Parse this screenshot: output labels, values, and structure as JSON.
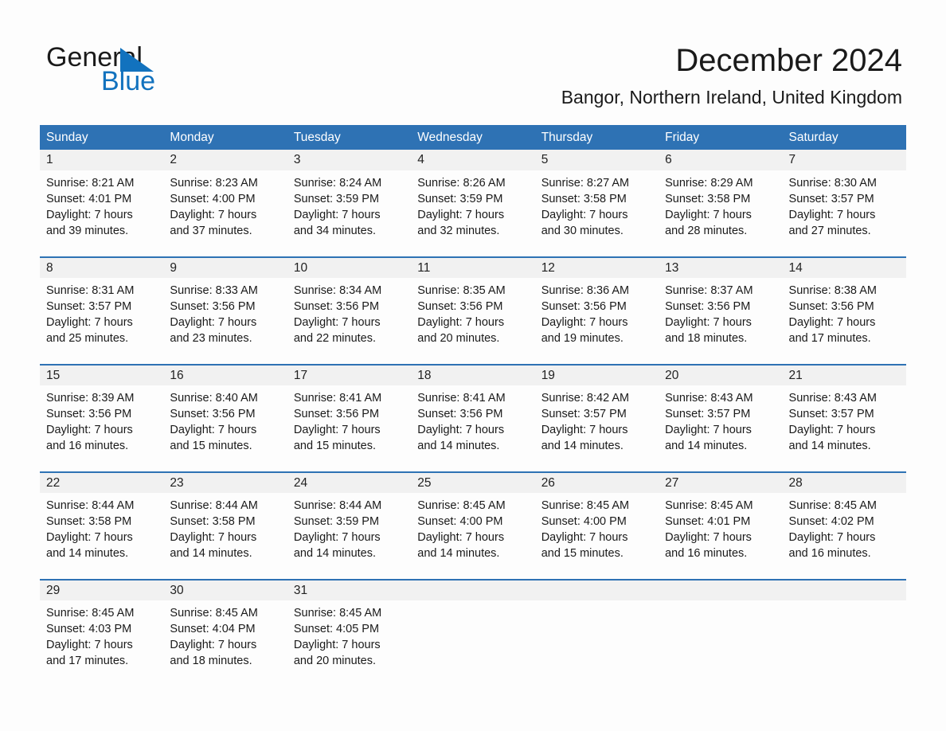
{
  "brand": {
    "name_part1": "General",
    "name_part2": "Blue",
    "accent_color": "#1272be"
  },
  "header": {
    "title": "December 2024",
    "subtitle": "Bangor, Northern Ireland, United Kingdom"
  },
  "theme": {
    "header_blue": "#2e72b4",
    "daynum_gray": "#f1f1f1",
    "page_background": "#fdfdfd"
  },
  "calendar": {
    "weekdays": [
      "Sunday",
      "Monday",
      "Tuesday",
      "Wednesday",
      "Thursday",
      "Friday",
      "Saturday"
    ],
    "weeks": [
      {
        "days": [
          {
            "num": "1",
            "sunrise": "Sunrise: 8:21 AM",
            "sunset": "Sunset: 4:01 PM",
            "daylight_line1": "Daylight: 7 hours",
            "daylight_line2": "and 39 minutes."
          },
          {
            "num": "2",
            "sunrise": "Sunrise: 8:23 AM",
            "sunset": "Sunset: 4:00 PM",
            "daylight_line1": "Daylight: 7 hours",
            "daylight_line2": "and 37 minutes."
          },
          {
            "num": "3",
            "sunrise": "Sunrise: 8:24 AM",
            "sunset": "Sunset: 3:59 PM",
            "daylight_line1": "Daylight: 7 hours",
            "daylight_line2": "and 34 minutes."
          },
          {
            "num": "4",
            "sunrise": "Sunrise: 8:26 AM",
            "sunset": "Sunset: 3:59 PM",
            "daylight_line1": "Daylight: 7 hours",
            "daylight_line2": "and 32 minutes."
          },
          {
            "num": "5",
            "sunrise": "Sunrise: 8:27 AM",
            "sunset": "Sunset: 3:58 PM",
            "daylight_line1": "Daylight: 7 hours",
            "daylight_line2": "and 30 minutes."
          },
          {
            "num": "6",
            "sunrise": "Sunrise: 8:29 AM",
            "sunset": "Sunset: 3:58 PM",
            "daylight_line1": "Daylight: 7 hours",
            "daylight_line2": "and 28 minutes."
          },
          {
            "num": "7",
            "sunrise": "Sunrise: 8:30 AM",
            "sunset": "Sunset: 3:57 PM",
            "daylight_line1": "Daylight: 7 hours",
            "daylight_line2": "and 27 minutes."
          }
        ]
      },
      {
        "days": [
          {
            "num": "8",
            "sunrise": "Sunrise: 8:31 AM",
            "sunset": "Sunset: 3:57 PM",
            "daylight_line1": "Daylight: 7 hours",
            "daylight_line2": "and 25 minutes."
          },
          {
            "num": "9",
            "sunrise": "Sunrise: 8:33 AM",
            "sunset": "Sunset: 3:56 PM",
            "daylight_line1": "Daylight: 7 hours",
            "daylight_line2": "and 23 minutes."
          },
          {
            "num": "10",
            "sunrise": "Sunrise: 8:34 AM",
            "sunset": "Sunset: 3:56 PM",
            "daylight_line1": "Daylight: 7 hours",
            "daylight_line2": "and 22 minutes."
          },
          {
            "num": "11",
            "sunrise": "Sunrise: 8:35 AM",
            "sunset": "Sunset: 3:56 PM",
            "daylight_line1": "Daylight: 7 hours",
            "daylight_line2": "and 20 minutes."
          },
          {
            "num": "12",
            "sunrise": "Sunrise: 8:36 AM",
            "sunset": "Sunset: 3:56 PM",
            "daylight_line1": "Daylight: 7 hours",
            "daylight_line2": "and 19 minutes."
          },
          {
            "num": "13",
            "sunrise": "Sunrise: 8:37 AM",
            "sunset": "Sunset: 3:56 PM",
            "daylight_line1": "Daylight: 7 hours",
            "daylight_line2": "and 18 minutes."
          },
          {
            "num": "14",
            "sunrise": "Sunrise: 8:38 AM",
            "sunset": "Sunset: 3:56 PM",
            "daylight_line1": "Daylight: 7 hours",
            "daylight_line2": "and 17 minutes."
          }
        ]
      },
      {
        "days": [
          {
            "num": "15",
            "sunrise": "Sunrise: 8:39 AM",
            "sunset": "Sunset: 3:56 PM",
            "daylight_line1": "Daylight: 7 hours",
            "daylight_line2": "and 16 minutes."
          },
          {
            "num": "16",
            "sunrise": "Sunrise: 8:40 AM",
            "sunset": "Sunset: 3:56 PM",
            "daylight_line1": "Daylight: 7 hours",
            "daylight_line2": "and 15 minutes."
          },
          {
            "num": "17",
            "sunrise": "Sunrise: 8:41 AM",
            "sunset": "Sunset: 3:56 PM",
            "daylight_line1": "Daylight: 7 hours",
            "daylight_line2": "and 15 minutes."
          },
          {
            "num": "18",
            "sunrise": "Sunrise: 8:41 AM",
            "sunset": "Sunset: 3:56 PM",
            "daylight_line1": "Daylight: 7 hours",
            "daylight_line2": "and 14 minutes."
          },
          {
            "num": "19",
            "sunrise": "Sunrise: 8:42 AM",
            "sunset": "Sunset: 3:57 PM",
            "daylight_line1": "Daylight: 7 hours",
            "daylight_line2": "and 14 minutes."
          },
          {
            "num": "20",
            "sunrise": "Sunrise: 8:43 AM",
            "sunset": "Sunset: 3:57 PM",
            "daylight_line1": "Daylight: 7 hours",
            "daylight_line2": "and 14 minutes."
          },
          {
            "num": "21",
            "sunrise": "Sunrise: 8:43 AM",
            "sunset": "Sunset: 3:57 PM",
            "daylight_line1": "Daylight: 7 hours",
            "daylight_line2": "and 14 minutes."
          }
        ]
      },
      {
        "days": [
          {
            "num": "22",
            "sunrise": "Sunrise: 8:44 AM",
            "sunset": "Sunset: 3:58 PM",
            "daylight_line1": "Daylight: 7 hours",
            "daylight_line2": "and 14 minutes."
          },
          {
            "num": "23",
            "sunrise": "Sunrise: 8:44 AM",
            "sunset": "Sunset: 3:58 PM",
            "daylight_line1": "Daylight: 7 hours",
            "daylight_line2": "and 14 minutes."
          },
          {
            "num": "24",
            "sunrise": "Sunrise: 8:44 AM",
            "sunset": "Sunset: 3:59 PM",
            "daylight_line1": "Daylight: 7 hours",
            "daylight_line2": "and 14 minutes."
          },
          {
            "num": "25",
            "sunrise": "Sunrise: 8:45 AM",
            "sunset": "Sunset: 4:00 PM",
            "daylight_line1": "Daylight: 7 hours",
            "daylight_line2": "and 14 minutes."
          },
          {
            "num": "26",
            "sunrise": "Sunrise: 8:45 AM",
            "sunset": "Sunset: 4:00 PM",
            "daylight_line1": "Daylight: 7 hours",
            "daylight_line2": "and 15 minutes."
          },
          {
            "num": "27",
            "sunrise": "Sunrise: 8:45 AM",
            "sunset": "Sunset: 4:01 PM",
            "daylight_line1": "Daylight: 7 hours",
            "daylight_line2": "and 16 minutes."
          },
          {
            "num": "28",
            "sunrise": "Sunrise: 8:45 AM",
            "sunset": "Sunset: 4:02 PM",
            "daylight_line1": "Daylight: 7 hours",
            "daylight_line2": "and 16 minutes."
          }
        ]
      },
      {
        "days": [
          {
            "num": "29",
            "sunrise": "Sunrise: 8:45 AM",
            "sunset": "Sunset: 4:03 PM",
            "daylight_line1": "Daylight: 7 hours",
            "daylight_line2": "and 17 minutes."
          },
          {
            "num": "30",
            "sunrise": "Sunrise: 8:45 AM",
            "sunset": "Sunset: 4:04 PM",
            "daylight_line1": "Daylight: 7 hours",
            "daylight_line2": "and 18 minutes."
          },
          {
            "num": "31",
            "sunrise": "Sunrise: 8:45 AM",
            "sunset": "Sunset: 4:05 PM",
            "daylight_line1": "Daylight: 7 hours",
            "daylight_line2": "and 20 minutes."
          },
          {
            "num": "",
            "sunrise": "",
            "sunset": "",
            "daylight_line1": "",
            "daylight_line2": ""
          },
          {
            "num": "",
            "sunrise": "",
            "sunset": "",
            "daylight_line1": "",
            "daylight_line2": ""
          },
          {
            "num": "",
            "sunrise": "",
            "sunset": "",
            "daylight_line1": "",
            "daylight_line2": ""
          },
          {
            "num": "",
            "sunrise": "",
            "sunset": "",
            "daylight_line1": "",
            "daylight_line2": ""
          }
        ]
      }
    ]
  }
}
